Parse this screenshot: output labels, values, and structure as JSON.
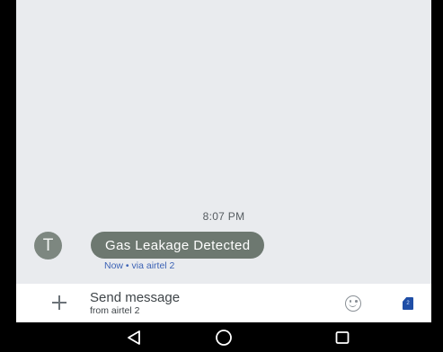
{
  "conversation": {
    "timestamp": "8:07 PM",
    "messages": [
      {
        "avatar_initial": "T",
        "text": "Gas Leakage Detected",
        "meta": "Now • via airtel 2"
      }
    ]
  },
  "composer": {
    "placeholder": "Send message",
    "sub_label": "from airtel 2",
    "sim_badge": "2",
    "icons": {
      "add": "plus-icon",
      "emoji": "emoji-smiley-icon",
      "sim": "sim-card-icon"
    }
  },
  "navigation_bar": {
    "icons": [
      "back-triangle-icon",
      "home-circle-icon",
      "recents-square-icon"
    ]
  },
  "colors": {
    "chat_background": "#e9ebee",
    "bubble": "#6d7870",
    "meta_text": "#3d63b5",
    "sim_badge": "#1f4ea6"
  }
}
